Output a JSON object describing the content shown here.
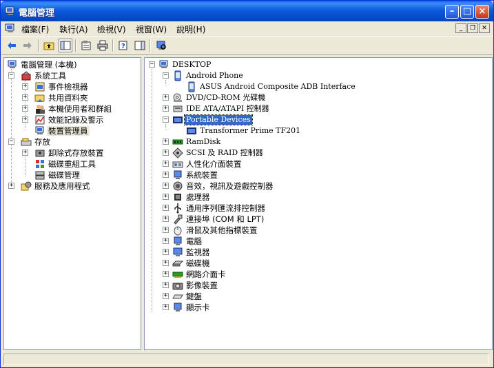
{
  "window": {
    "title": "電腦管理",
    "buttons": {
      "minimize": "–",
      "maximize": "□",
      "close": "×"
    }
  },
  "menu": {
    "items": [
      {
        "label": "檔案(F)"
      },
      {
        "label": "執行(A)"
      },
      {
        "label": "檢視(V)"
      },
      {
        "label": "視窗(W)"
      },
      {
        "label": "說明(H)"
      }
    ]
  },
  "toolbar": {
    "icons": [
      "back-icon",
      "forward-icon",
      "up-folder-icon",
      "show-hide-tree-icon",
      "properties-icon",
      "print-icon",
      "help-icon",
      "show-hide-action-pane-icon",
      "scan-hardware-icon"
    ]
  },
  "left_tree": {
    "root": "電腦管理 (本機)",
    "system_tools": "系統工具",
    "event_viewer": "事件檢視器",
    "shared_folders": "共用資料夾",
    "local_users": "本機使用者和群組",
    "perf_logs": "效能記錄及警示",
    "device_manager": "裝置管理員",
    "storage": "存放",
    "removable_storage": "卸除式存放裝置",
    "defrag": "磁碟重組工具",
    "disk_mgmt": "磁碟管理",
    "services_apps": "服務及應用程式"
  },
  "right_tree": {
    "root": "DESKTOP",
    "android_phone": "Android Phone",
    "adb_interface": "ASUS Android Composite ADB Interface",
    "dvd": "DVD/CD-ROM 光碟機",
    "ide": "IDE ATA/ATAPI 控制器",
    "portable_devices": "Portable Devices",
    "transformer": "Transformer Prime TF201",
    "ramdisk": "RamDisk",
    "scsi": "SCSI 及 RAID 控制器",
    "hid": "人性化介面裝置",
    "system_devices": "系統裝置",
    "sound": "音效，視訊及遊戲控制器",
    "processors": "處理器",
    "usb": "通用序列匯流排控制器",
    "ports": "連接埠 (COM 和 LPT)",
    "mice": "滑鼠及其他指標裝置",
    "computer": "電腦",
    "monitors": "監視器",
    "disk_drives": "磁碟機",
    "network": "網路介面卡",
    "imaging": "影像裝置",
    "keyboards": "鍵盤",
    "display": "顯示卡"
  },
  "colors": {
    "titlebar": "#0a5fe6",
    "selection": "#316ac5",
    "face": "#ece9d8"
  }
}
